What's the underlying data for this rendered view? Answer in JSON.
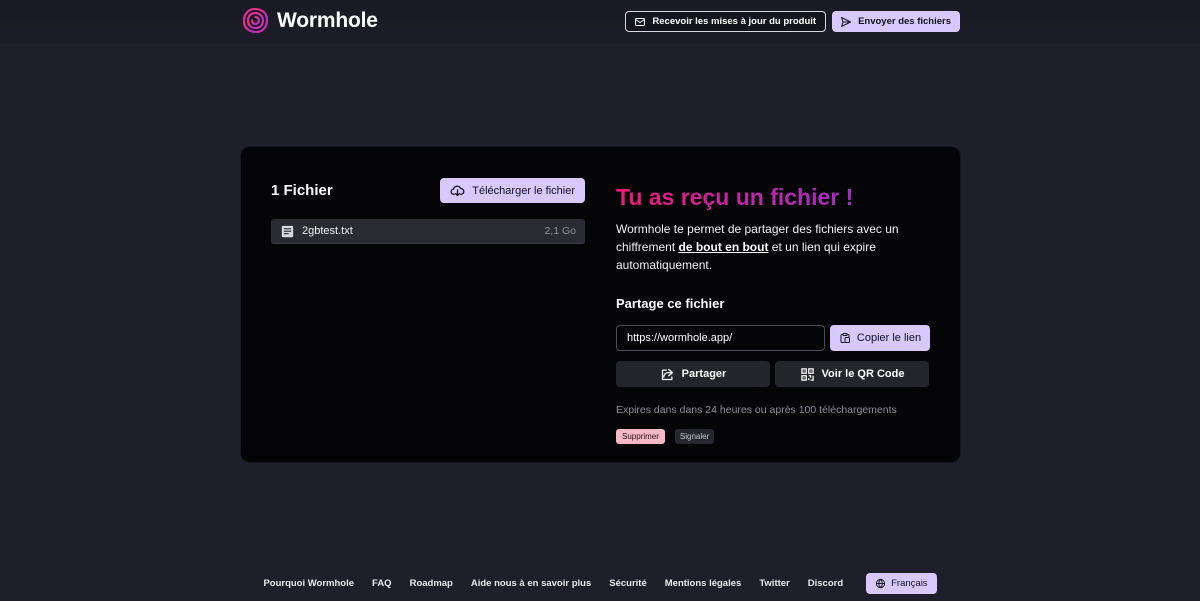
{
  "header": {
    "brand": "Wormhole",
    "updates_button": "Recevoir les mises à jour du produit",
    "send_button": "Envoyer des fichiers"
  },
  "files": {
    "title": "1 Fichier",
    "download_button": "Télécharger le fichier",
    "items": [
      {
        "name": "2gbtest.txt",
        "size": "2,1 Go"
      }
    ]
  },
  "share": {
    "headline": "Tu as reçu un fichier !",
    "description_before": "Wormhole te permet de partager des fichiers avec un chiffrement ",
    "description_emphasis": "de bout en bout",
    "description_after": " et un lien qui expire automatiquement.",
    "section_title": "Partage ce fichier",
    "link_value": "https://wormhole.app/",
    "copy_button": "Copier le lien",
    "share_button": "Partager",
    "qr_button": "Voir le QR Code",
    "expiry_text": "Expires dans dans 24 heures ou après 100 téléchargements",
    "delete_tag": "Supprimer",
    "report_tag": "Signaler"
  },
  "footer": {
    "links": [
      "Pourquoi Wormhole",
      "FAQ",
      "Roadmap",
      "Aide nous à en savoir plus",
      "Sécurité",
      "Mentions légales",
      "Twitter",
      "Discord"
    ],
    "language_button": "Français"
  },
  "colors": {
    "background": "#1e1f2b",
    "card": "#050508",
    "accent_lilac": "#d7c9ff",
    "headline_gradient_start": "#ee1a73",
    "headline_gradient_end": "#a62ec4",
    "delete_tag": "#f6b8c5"
  },
  "icons": {
    "logo": "wormhole-swirl-icon",
    "updates": "mail-icon",
    "send": "send-icon",
    "download": "cloud-download-icon",
    "file": "text-file-icon",
    "copy": "clipboard-icon",
    "share": "share-icon",
    "qr": "qr-code-icon",
    "language": "globe-icon"
  }
}
